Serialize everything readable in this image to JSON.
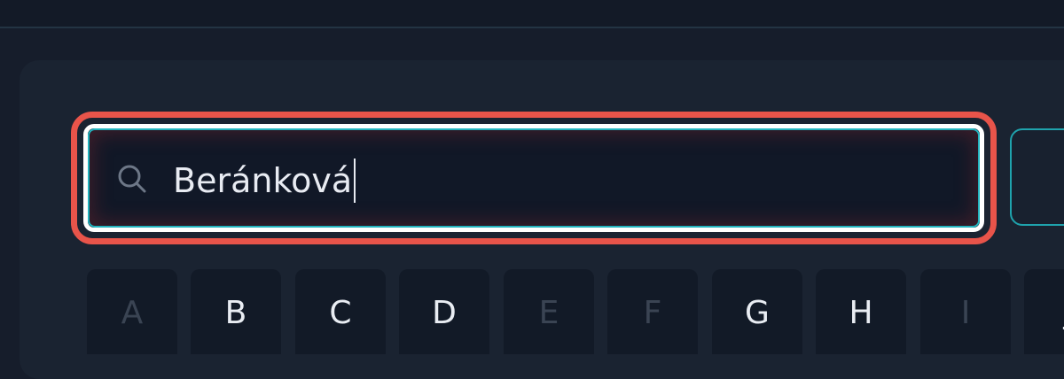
{
  "search": {
    "value": "Beránková",
    "icon": "search-icon"
  },
  "highlight_color": "#e8544a",
  "accent_color": "#23b4bf",
  "keyboard": {
    "keys": [
      {
        "label": "A",
        "enabled": false
      },
      {
        "label": "B",
        "enabled": true
      },
      {
        "label": "C",
        "enabled": true
      },
      {
        "label": "D",
        "enabled": true
      },
      {
        "label": "E",
        "enabled": false
      },
      {
        "label": "F",
        "enabled": false
      },
      {
        "label": "G",
        "enabled": true
      },
      {
        "label": "H",
        "enabled": true
      },
      {
        "label": "I",
        "enabled": false
      },
      {
        "label": "J",
        "enabled": true
      }
    ]
  }
}
